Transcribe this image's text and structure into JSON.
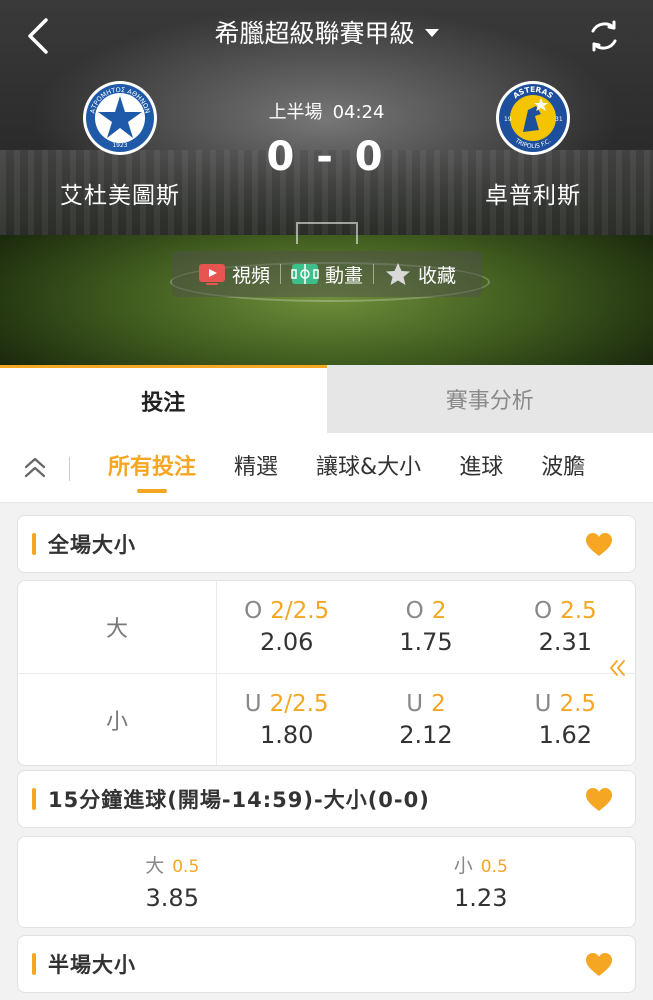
{
  "header": {
    "league": "希臘超級聯賽甲級",
    "back_icon": "chevron-left-icon",
    "refresh_icon": "refresh-icon"
  },
  "match": {
    "home": {
      "name": "艾杜美圖斯",
      "logo_text": "ΑΤΡΟΜΗΤΟΣ ΑΘΗΝΩΝ",
      "logo_year": "1923"
    },
    "away": {
      "name": "卓普利斯",
      "logo_text_top": "ASTERAS",
      "logo_text_bottom": "TRIPOLIS F.C.",
      "logo_left": "19",
      "logo_right": "31"
    },
    "period": "上半場",
    "clock": "04:24",
    "score": "0 - 0"
  },
  "actions": [
    {
      "label": "視頻",
      "icon": "video-icon"
    },
    {
      "label": "動畫",
      "icon": "animation-pitch-icon"
    },
    {
      "label": "收藏",
      "icon": "star-icon"
    }
  ],
  "main_tabs": [
    {
      "label": "投注",
      "active": true
    },
    {
      "label": "賽事分析",
      "active": false
    }
  ],
  "sub_tabs": [
    {
      "label": "所有投注",
      "active": true
    },
    {
      "label": "精選",
      "active": false
    },
    {
      "label": "讓球&大小",
      "active": false
    },
    {
      "label": "進球",
      "active": false
    },
    {
      "label": "波膽",
      "active": false
    }
  ],
  "markets": [
    {
      "title": "全場大小",
      "rows": [
        {
          "label": "大",
          "cells": [
            {
              "side": "O",
              "handicap": "2/2.5",
              "price": "2.06"
            },
            {
              "side": "O",
              "handicap": "2",
              "price": "1.75"
            },
            {
              "side": "O",
              "handicap": "2.5",
              "price": "2.31"
            }
          ]
        },
        {
          "label": "小",
          "cells": [
            {
              "side": "U",
              "handicap": "2/2.5",
              "price": "1.80"
            },
            {
              "side": "U",
              "handicap": "2",
              "price": "2.12"
            },
            {
              "side": "U",
              "handicap": "2.5",
              "price": "1.62"
            }
          ]
        }
      ]
    },
    {
      "title": "15分鐘進球(開場-14:59)-大小(0-0)",
      "cells": [
        {
          "side": "大",
          "handicap": "0.5",
          "price": "3.85"
        },
        {
          "side": "小",
          "handicap": "0.5",
          "price": "1.23"
        }
      ]
    },
    {
      "title": "半場大小"
    }
  ],
  "colors": {
    "accent": "#f5a623"
  }
}
